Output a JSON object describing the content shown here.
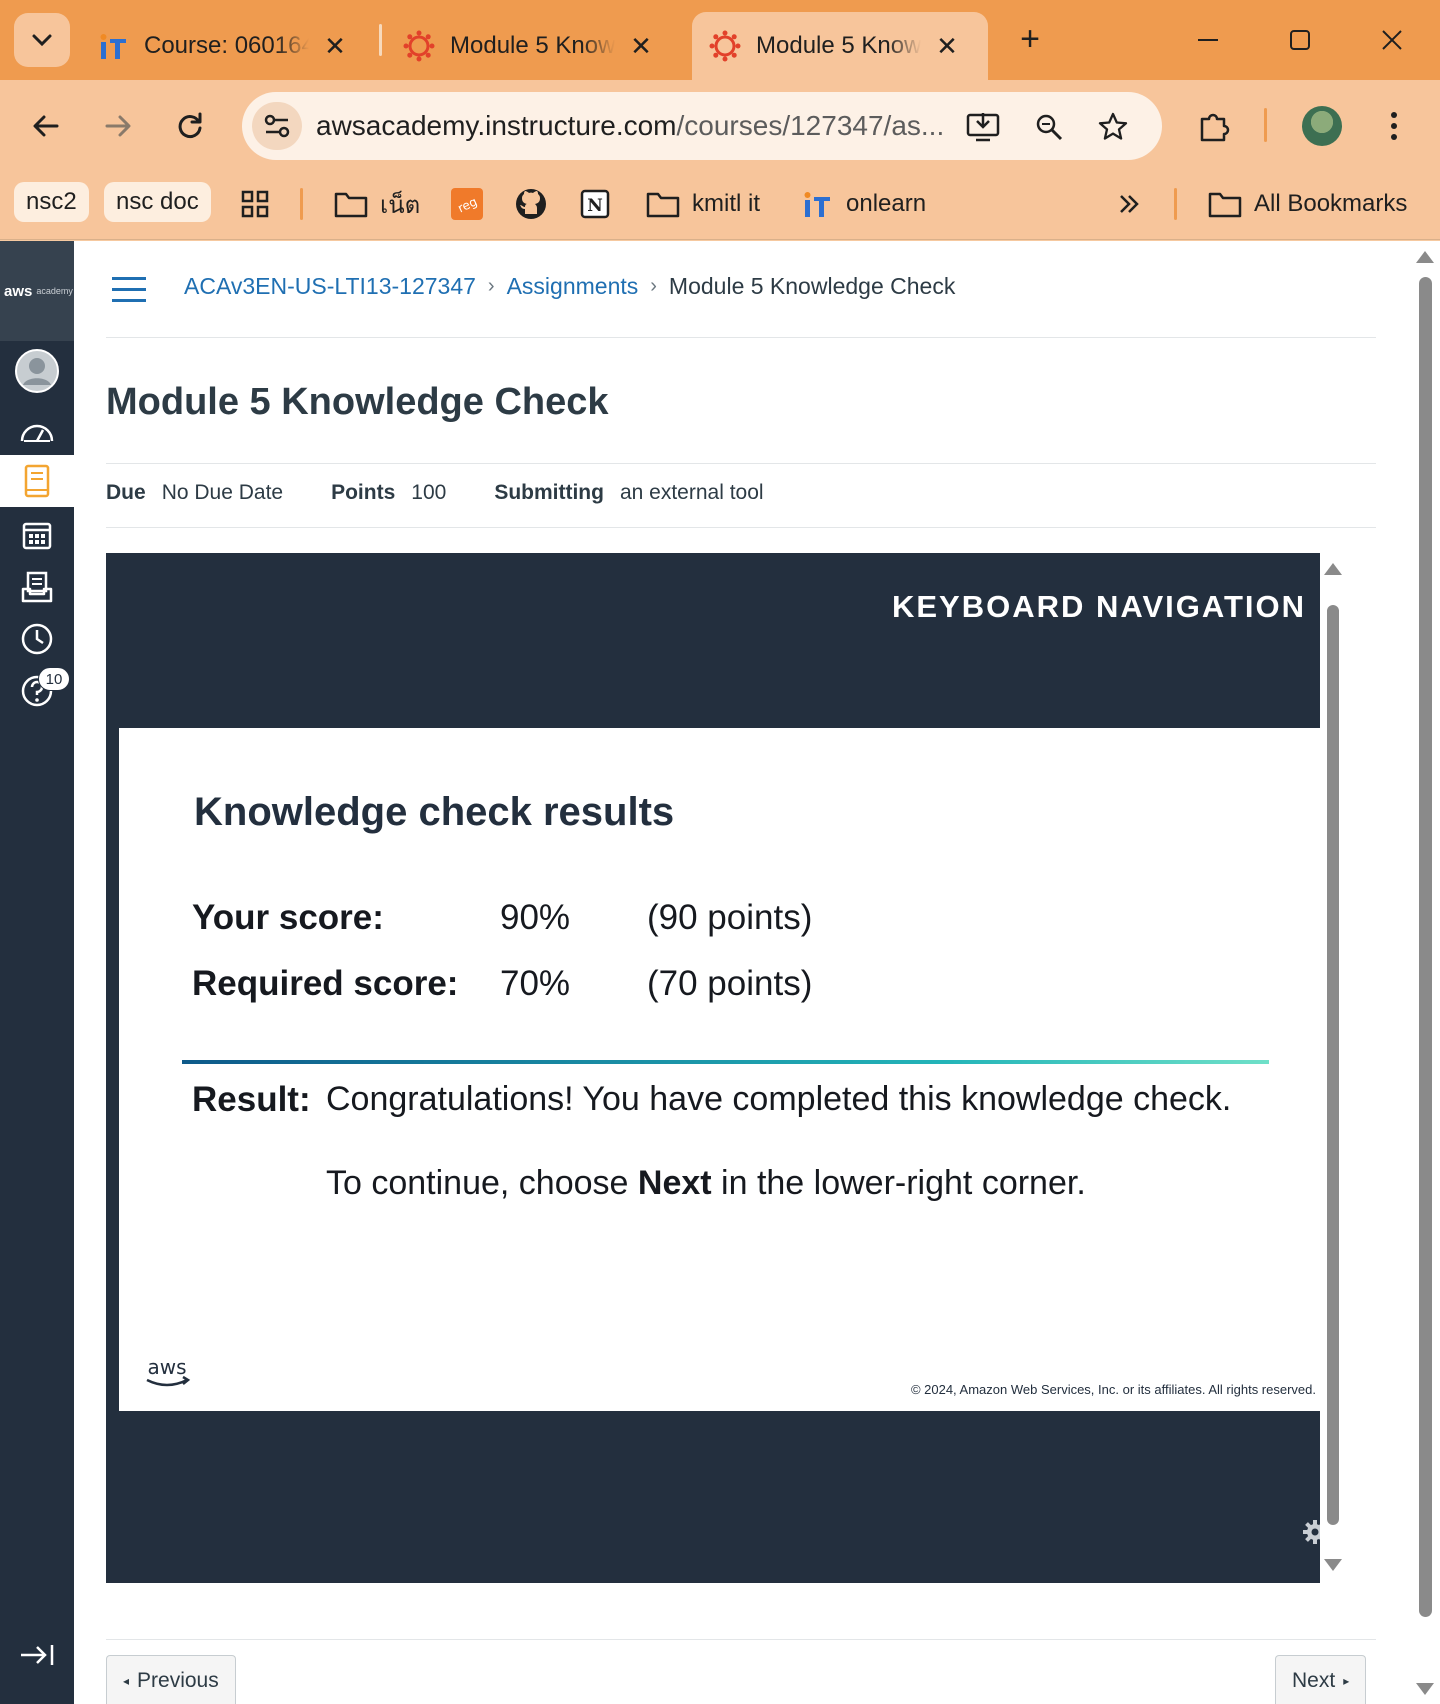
{
  "browser": {
    "tabs": [
      {
        "title": "Course: 060164",
        "favicon": "it-logo-icon"
      },
      {
        "title": "Module 5 Know",
        "favicon": "canvas-logo-icon"
      },
      {
        "title": "Module 5 Know",
        "favicon": "canvas-logo-icon",
        "active": true
      }
    ],
    "url_host": "awsacademy.instructure.com",
    "url_path": "/courses/127347/as...",
    "bookmarks": {
      "chip1": "nsc2",
      "chip2": "nsc doc",
      "folder1": "เน็ต",
      "folder2": "kmitl it",
      "link1": "onlearn",
      "all": "All Bookmarks"
    },
    "colors": {
      "tabstrip": "#ef9b4f",
      "toolbar": "#f7c59b"
    }
  },
  "global_nav": {
    "logo_text": "aws",
    "logo_sub": "academy",
    "help_badge": "10"
  },
  "breadcrumb": {
    "course": "ACAv3EN-US-LTI13-127347",
    "assignments": "Assignments",
    "current": "Module 5 Knowledge Check"
  },
  "assignment": {
    "title": "Module 5 Knowledge Check",
    "due_label": "Due",
    "due_value": "No Due Date",
    "points_label": "Points",
    "points_value": "100",
    "submitting_label": "Submitting",
    "submitting_value": "an external tool"
  },
  "tool": {
    "keyboard_nav": "KEYBOARD NAVIGATION",
    "results_title": "Knowledge check results",
    "your_score_label": "Your score:",
    "your_score_pct": "90%",
    "your_score_pts": "(90 points)",
    "required_label": "Required score:",
    "required_pct": "70%",
    "required_pts": "(70 points)",
    "result_label": "Result:",
    "result_message": "Congratulations! You have completed this knowledge check.",
    "continue_pre": "To continue, choose ",
    "continue_bold": "Next",
    "continue_post": " in the lower-right corner.",
    "logo_text": "aws",
    "copyright": "© 2024, Amazon Web Services, Inc. or its affiliates. All rights reserved.",
    "colors": {
      "background": "#232f3e",
      "accent_start": "#0e5a8a",
      "accent_end": "#6fe0c8"
    }
  },
  "footer": {
    "previous": "Previous",
    "next": "Next"
  }
}
